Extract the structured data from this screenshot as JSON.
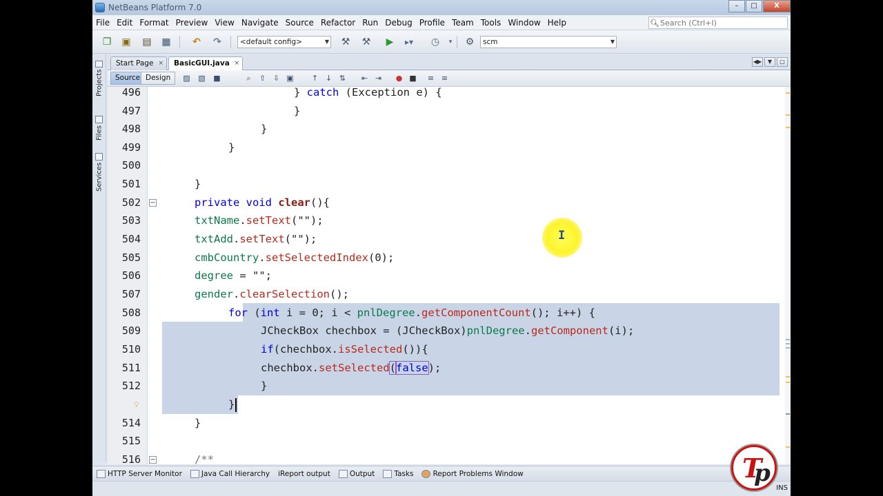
{
  "window": {
    "title": "NetBeans Platform 7.0",
    "controls": [
      "–",
      "□",
      "X"
    ]
  },
  "menu": [
    "File",
    "Edit",
    "Format",
    "Preview",
    "View",
    "Navigate",
    "Source",
    "Refactor",
    "Run",
    "Debug",
    "Profile",
    "Team",
    "Tools",
    "Window",
    "Help"
  ],
  "search": {
    "placeholder": "Search (Ctrl+I)"
  },
  "toolbar": {
    "config_value": "<default config>",
    "scm_value": "scm"
  },
  "sidebar": {
    "tabs": [
      "Projects",
      "Files",
      "Services"
    ]
  },
  "editor_tabs": [
    {
      "label": "Start Page",
      "close": "×"
    },
    {
      "label": "BasicGUI.java",
      "close": "×"
    }
  ],
  "editor_toolbar": {
    "source_label": "Source",
    "design_label": "Design"
  },
  "code": {
    "lines": [
      {
        "n": "496"
      },
      {
        "n": "497"
      },
      {
        "n": "498"
      },
      {
        "n": "499"
      },
      {
        "n": "500"
      },
      {
        "n": "501"
      },
      {
        "n": "502"
      },
      {
        "n": "503"
      },
      {
        "n": "504"
      },
      {
        "n": "505"
      },
      {
        "n": "506"
      },
      {
        "n": "507"
      },
      {
        "n": "508"
      },
      {
        "n": "509"
      },
      {
        "n": "510"
      },
      {
        "n": "511"
      },
      {
        "n": "512"
      },
      {
        "n": "",
        "hint": true
      },
      {
        "n": "514"
      },
      {
        "n": "515"
      },
      {
        "n": "516"
      }
    ],
    "text": {
      "l496_a": "} ",
      "l496_kw": "catch",
      "l496_b": " (Exception e) {",
      "l497": "}",
      "l498": "}",
      "l499": "}",
      "l501": "}",
      "l502_kw": "private void ",
      "l502_m": "clear",
      "l502_b": "(){",
      "l503_v": "txtName",
      "l503_dot": ".",
      "l503_m": "setText",
      "l503_b": "(\"\");",
      "l504_v": "txtAdd",
      "l504_dot": ".",
      "l504_m": "setText",
      "l504_b": "(\"\");",
      "l505_v": "cmbCountry",
      "l505_dot": ".",
      "l505_m": "setSelectedIndex",
      "l505_b": "(0);",
      "l506_v": "degree",
      "l506_b": " = \"\";",
      "l507_v": "gender",
      "l507_dot": ".",
      "l507_m": "clearSelection",
      "l507_b": "();",
      "l508_kw": "for",
      "l508_a": " (",
      "l508_kw2": "int",
      "l508_b": " i = 0; i < ",
      "l508_v": "pnlDegree",
      "l508_dot": ".",
      "l508_m": "getComponentCount",
      "l508_c": "(); i++) {",
      "l509_a": "JCheckBox chechbox = (JCheckBox)",
      "l509_v": "pnlDegree",
      "l509_dot": ".",
      "l509_m": "getComponent",
      "l509_b": "(i);",
      "l510_kw": "if",
      "l510_a": "(chechbox.",
      "l510_m": "isSelected",
      "l510_b": "()){",
      "l511_a": "chechbox.",
      "l511_m": "setSelected",
      "l511_p": "(",
      "l511_kw": "false",
      "l511_b": ");",
      "l512": "}",
      "l513": "}",
      "l514": "}",
      "l516": "/**"
    }
  },
  "bottom_windows": [
    "HTTP Server Monitor",
    "Java Call Hierarchy",
    "iReport output",
    "Output",
    "Tasks",
    "Report Problems Window"
  ],
  "status": {
    "mode": "INS"
  },
  "colors": {
    "keyword": "#0000e6",
    "method": "#b8291b",
    "field": "#0b7a4a",
    "selection": "#c9d5e6",
    "cursor_highlight": "#fdf32d"
  }
}
